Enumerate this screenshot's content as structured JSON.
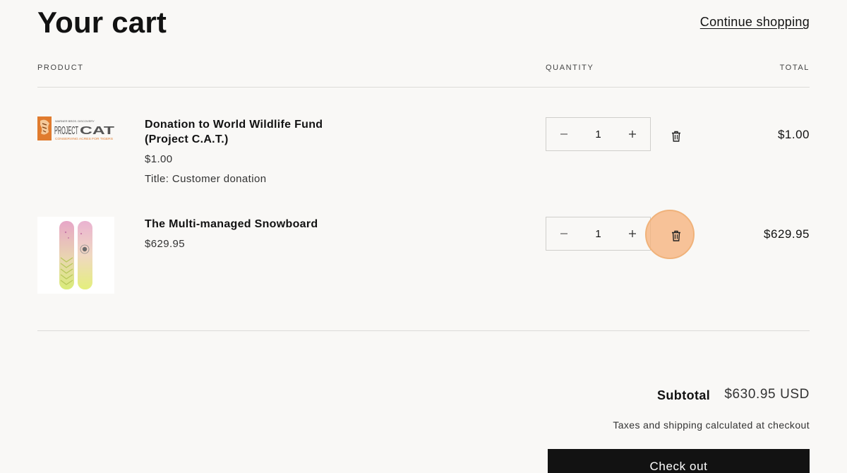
{
  "header": {
    "title": "Your cart",
    "continue_link": "Continue shopping"
  },
  "columns": {
    "product": "PRODUCT",
    "quantity": "QUANTITY",
    "total": "TOTAL"
  },
  "items": [
    {
      "name": "Donation to World Wildlife Fund (Project C.A.T.)",
      "price": "$1.00",
      "option": "Title: Customer donation",
      "quantity": "1",
      "line_total": "$1.00",
      "image_text": {
        "brand_small": "WARNER BROS. DISCOVERY",
        "logo_left": "PROJECT",
        "logo_right": "CAT",
        "tagline": "CONSERVING ACRES FOR TIGERS"
      }
    },
    {
      "name": "The Multi-managed Snowboard",
      "price": "$629.95",
      "quantity": "1",
      "line_total": "$629.95"
    }
  ],
  "qty_controls": {
    "minus": "−",
    "plus": "+"
  },
  "summary": {
    "subtotal_label": "Subtotal",
    "subtotal_value": "$630.95 USD",
    "tax_note": "Taxes and shipping calculated at checkout",
    "checkout_label": "Check out"
  },
  "colors": {
    "background": "#f9f8f6",
    "text": "#121212",
    "checkout_bg": "#121212",
    "highlight": "#f5b078"
  },
  "icons": {
    "remove": "trash-icon",
    "minus": "minus-icon",
    "plus": "plus-icon"
  }
}
